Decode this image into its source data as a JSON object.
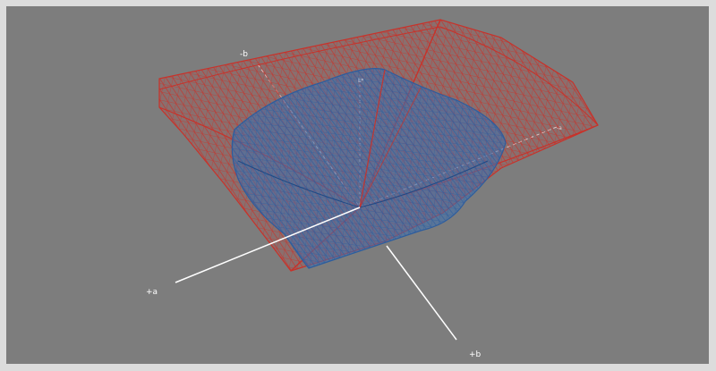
{
  "viewer": {
    "background_color": "#7d7d7d",
    "frame_color": "#dcdcdc"
  },
  "axes": {
    "plus_a": "+a",
    "plus_b": "+b",
    "minus_b": "-b",
    "minus_a": "-a",
    "l": "L*"
  },
  "surfaces": {
    "outer_gamut": {
      "name": "red-wireframe-gamut",
      "color": "#c8322a"
    },
    "inner_gamut": {
      "name": "blue-wireframe-gamut",
      "color": "#3d6fb0"
    }
  }
}
